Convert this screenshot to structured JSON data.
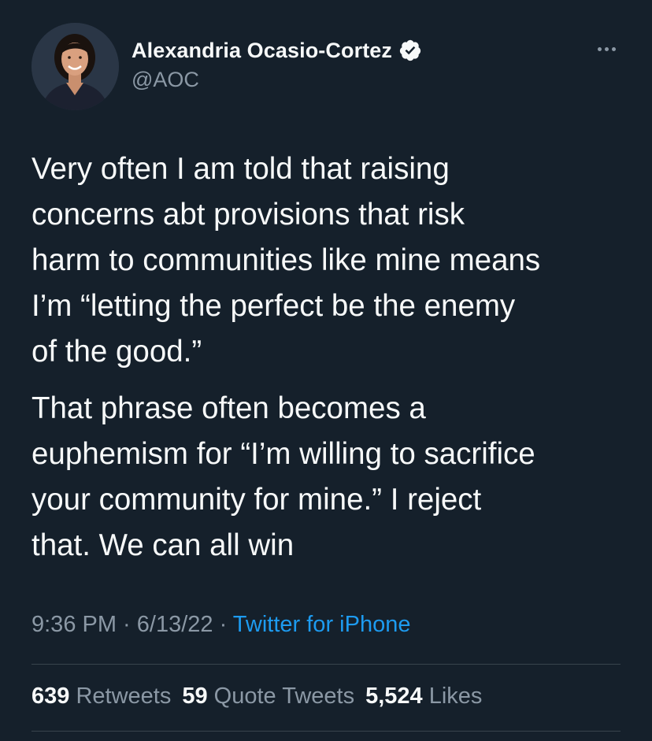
{
  "author": {
    "display_name": "Alexandria Ocasio-Cortez",
    "handle": "@AOC",
    "verified": true,
    "verified_icon": "verified-badge-icon",
    "more_icon": "more-horizontal-icon"
  },
  "tweet": {
    "paragraphs": [
      "Very often I am told that raising\nconcerns abt provisions that risk\nharm to communities like mine means\nI’m “letting the perfect be the enemy\nof the good.”",
      "That phrase often becomes a\neuphemism for “I’m willing to sacrifice\nyour community for mine.” I reject\nthat. We can all win"
    ]
  },
  "meta": {
    "time": "9:36 PM",
    "separator": " · ",
    "date": "6/13/22",
    "source": "Twitter for iPhone"
  },
  "stats": {
    "retweets_count": "639",
    "retweets_label": "Retweets",
    "quotes_count": "59",
    "quotes_label": "Quote Tweets",
    "likes_count": "5,524",
    "likes_label": "Likes"
  },
  "colors": {
    "background": "#15202b",
    "text_primary": "#f7f9f9",
    "text_secondary": "#8b98a5",
    "link": "#1d9bf0",
    "divider": "#38444d"
  }
}
